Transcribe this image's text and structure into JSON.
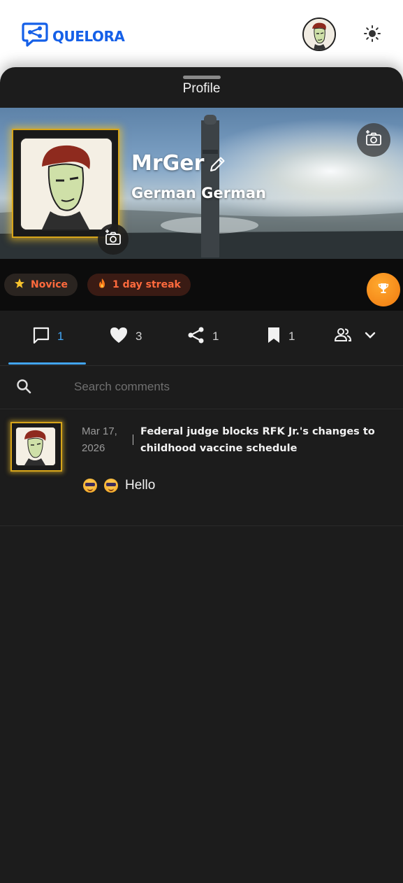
{
  "header": {
    "logo_text": "QUELORA",
    "brand_color": "#1560e8",
    "icons": [
      "share-chat-logo-icon",
      "user-avatar",
      "sun-icon"
    ]
  },
  "sheet": {
    "title": "Profile"
  },
  "profile": {
    "username": "MrGer",
    "full_name": "German German"
  },
  "badges": {
    "level_label": "Novice",
    "streak_label": "1 day streak"
  },
  "tabs": [
    {
      "icon": "comment-icon",
      "count": "1",
      "active": true
    },
    {
      "icon": "heart-icon",
      "count": "3"
    },
    {
      "icon": "share-icon",
      "count": "1"
    },
    {
      "icon": "bookmark-icon",
      "count": "1"
    },
    {
      "icon": "people-icon",
      "dropdown": "chevron-down-icon"
    }
  ],
  "search": {
    "placeholder": "Search comments"
  },
  "comments": [
    {
      "date_line1": "Mar 17,",
      "date_line2": "2026",
      "article_title": "Federal judge blocks RFK Jr.'s changes to childhood vaccine schedule",
      "text": "Hello",
      "emoji": [
        "smiling-face-with-sunglasses",
        "smiling-face-with-sunglasses"
      ]
    }
  ],
  "colors": {
    "sheet_bg": "#1c1c1c",
    "accent_blue": "#42a5f5",
    "badge_text": "#ff6a3d",
    "trophy_orange": "#f58a1a",
    "frame_gold": "#d7a51a"
  }
}
